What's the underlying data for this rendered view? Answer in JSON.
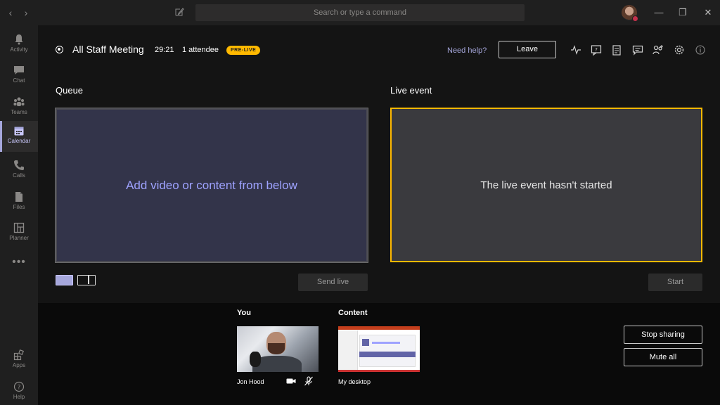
{
  "titlebar": {
    "search_placeholder": "Search or type a command",
    "back_icon": "chevron-left-icon",
    "forward_icon": "chevron-right-icon",
    "compose_icon": "compose-icon"
  },
  "rail": {
    "items": [
      {
        "label": "Activity",
        "icon": "bell-icon"
      },
      {
        "label": "Chat",
        "icon": "chat-icon"
      },
      {
        "label": "Teams",
        "icon": "teams-icon"
      },
      {
        "label": "Calendar",
        "icon": "calendar-icon",
        "active": true
      },
      {
        "label": "Calls",
        "icon": "phone-icon"
      },
      {
        "label": "Files",
        "icon": "file-icon"
      },
      {
        "label": "Planner",
        "icon": "planner-icon"
      }
    ],
    "more": "•••",
    "bottom": [
      {
        "label": "Apps",
        "icon": "apps-icon"
      },
      {
        "label": "Help",
        "icon": "help-icon"
      }
    ]
  },
  "header": {
    "title": "All Staff Meeting",
    "timer": "29:21",
    "attendees": "1 attendee",
    "status_badge": "PRE-LIVE",
    "help_link": "Need help?",
    "leave_label": "Leave"
  },
  "queue": {
    "label": "Queue",
    "placeholder": "Add video or content from below",
    "send_live_label": "Send live"
  },
  "live_event": {
    "label": "Live event",
    "status": "The live event hasn't started",
    "start_label": "Start"
  },
  "tray": {
    "you_label": "You",
    "content_label": "Content",
    "you_name": "Jon Hood",
    "content_name": "My desktop",
    "stop_sharing_label": "Stop sharing",
    "mute_all_label": "Mute all"
  },
  "colors": {
    "accent": "#a6a7dc",
    "live_border": "#ffb900",
    "queue_text": "#9ea2ff",
    "background": "#141414"
  }
}
